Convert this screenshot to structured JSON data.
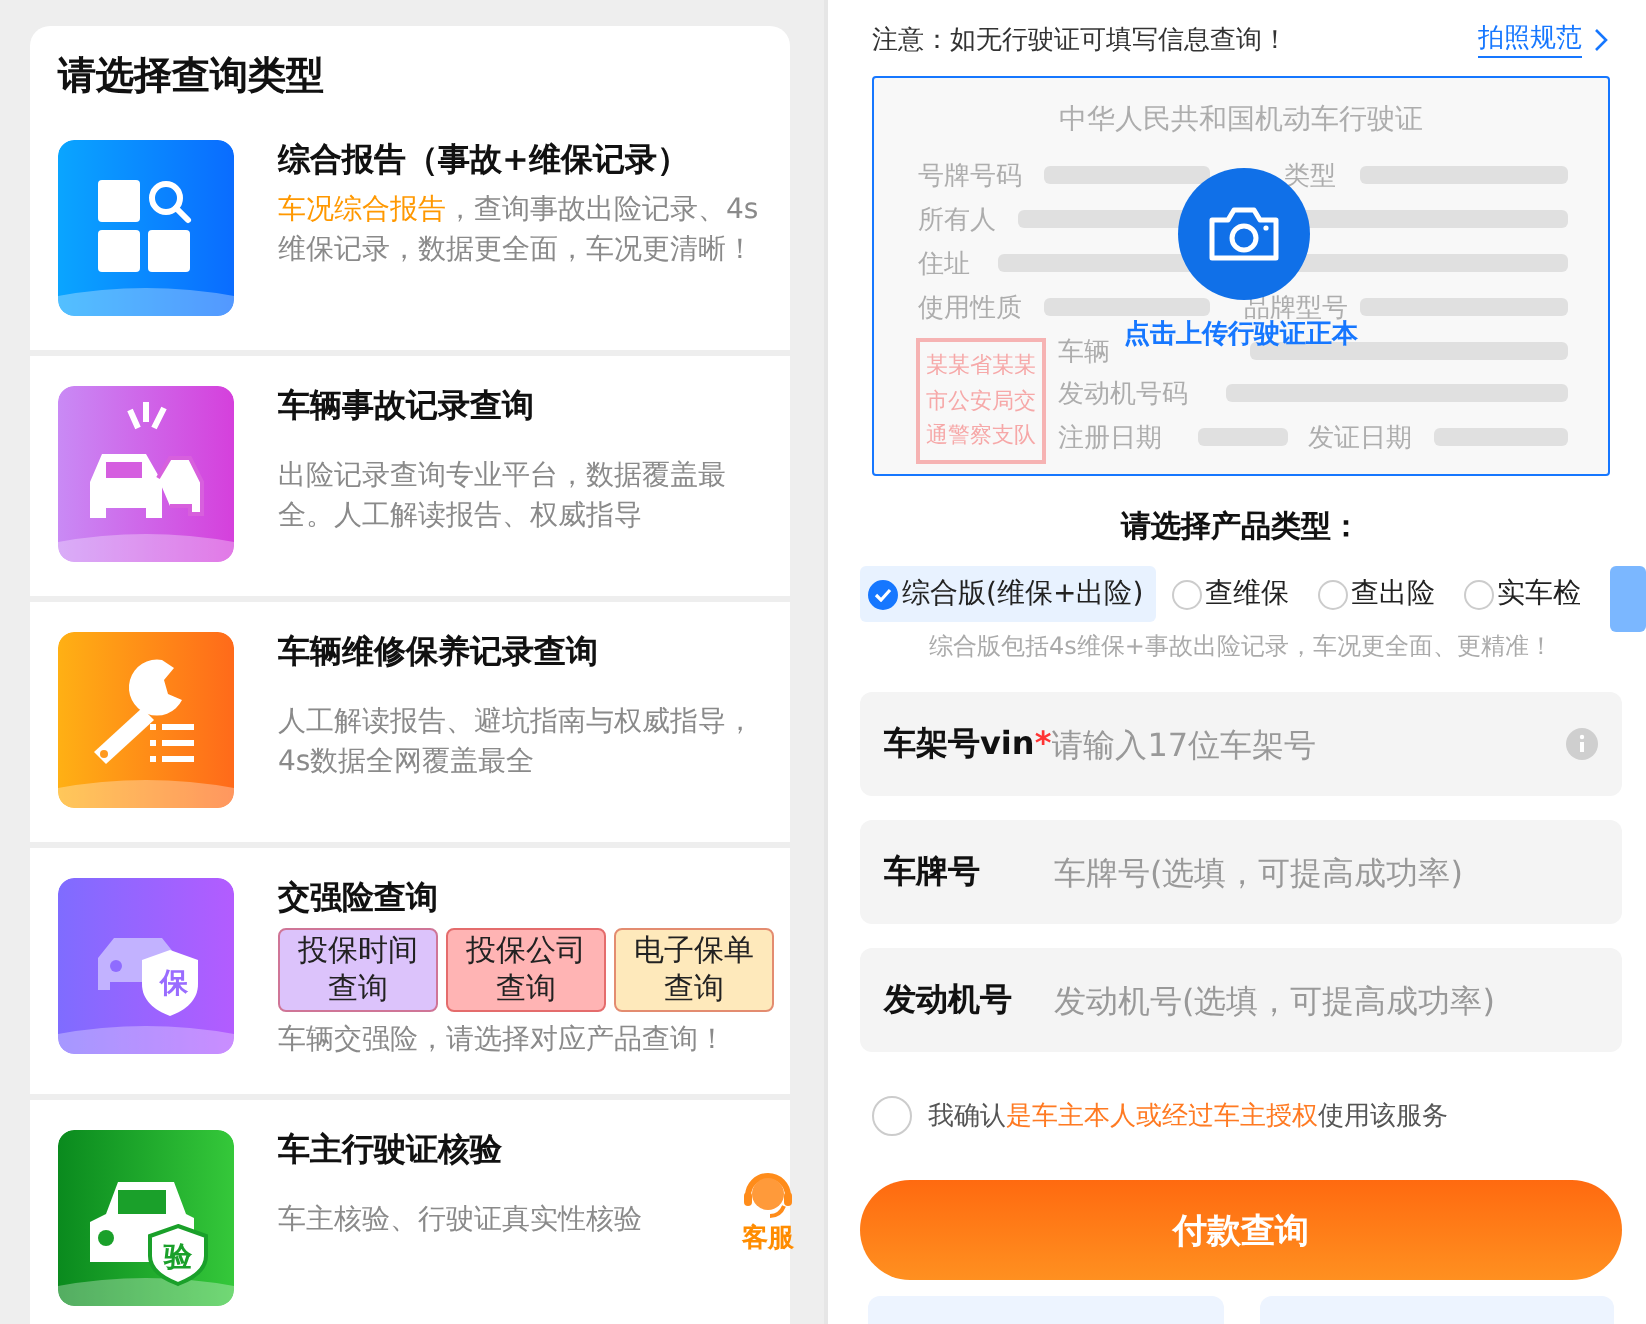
{
  "query_panel": {
    "title": "请选择查询类型",
    "items": [
      {
        "kind": "report",
        "title": "综合报告（事故+维保记录）",
        "highlight": "车况综合报告",
        "description": "，查询事故出险记录、4s维保记录，数据更全面，车况更清晰！"
      },
      {
        "kind": "accident",
        "title": "车辆事故记录查询",
        "description": "出险记录查询专业平台，数据覆盖最全。人工解读报告、权威指导"
      },
      {
        "kind": "repair",
        "title": "车辆维修保养记录查询",
        "description": "人工解读报告、避坑指南与权威指导，4s数据全网覆盖最全"
      },
      {
        "kind": "insurance",
        "title": "交强险查询",
        "badge": "保",
        "tags": [
          {
            "label": "投保时间查询",
            "color": "#dcc3fb"
          },
          {
            "label": "投保公司查询",
            "color": "#ffb4b4"
          },
          {
            "label": "电子保单查询",
            "color": "#fee9bb"
          }
        ],
        "description": "车辆交强险，请选择对应产品查询！"
      },
      {
        "kind": "verify",
        "title": "车主行驶证核验",
        "badge": "验",
        "description": "车主核验、行驶证真实性核验"
      }
    ]
  },
  "service": {
    "label": "客服"
  },
  "upload": {
    "notice": "注意：如无行驶证可填写信息查询！",
    "guide_link": "拍照规范",
    "license": {
      "title": "中华人民共和国机动车行驶证",
      "fields": [
        "号牌号码",
        "类型",
        "所有人",
        "住址",
        "使用性质",
        "品牌型号",
        "车辆",
        "发动机号码",
        "注册日期",
        "发证日期"
      ],
      "stamp": "某某省某某市公安局交通警察支队"
    },
    "action": "点击上传行驶证正本"
  },
  "product": {
    "title": "请选择产品类型：",
    "options": [
      {
        "label": "综合版(维保+出险)",
        "selected": true
      },
      {
        "label": "查维保",
        "selected": false
      },
      {
        "label": "查出险",
        "selected": false
      },
      {
        "label": "实车检",
        "selected": false
      }
    ],
    "hint": "综合版包括4s维保+事故出险记录，车况更全面、更精准！"
  },
  "fields": [
    {
      "label": "车架号vin",
      "marker": "*",
      "placeholder": "请输入17位车架号",
      "info": true
    },
    {
      "label": "车牌号",
      "placeholder": "车牌号(选填，可提高成功率)",
      "info": false
    },
    {
      "label": "发动机号",
      "placeholder": "发动机号(选填，可提高成功率)",
      "info": false
    }
  ],
  "consent": {
    "checked": false,
    "before": "我确认",
    "link": "是车主本人或经过车主授权",
    "after": "使用该服务"
  },
  "submit": "付款查询"
}
